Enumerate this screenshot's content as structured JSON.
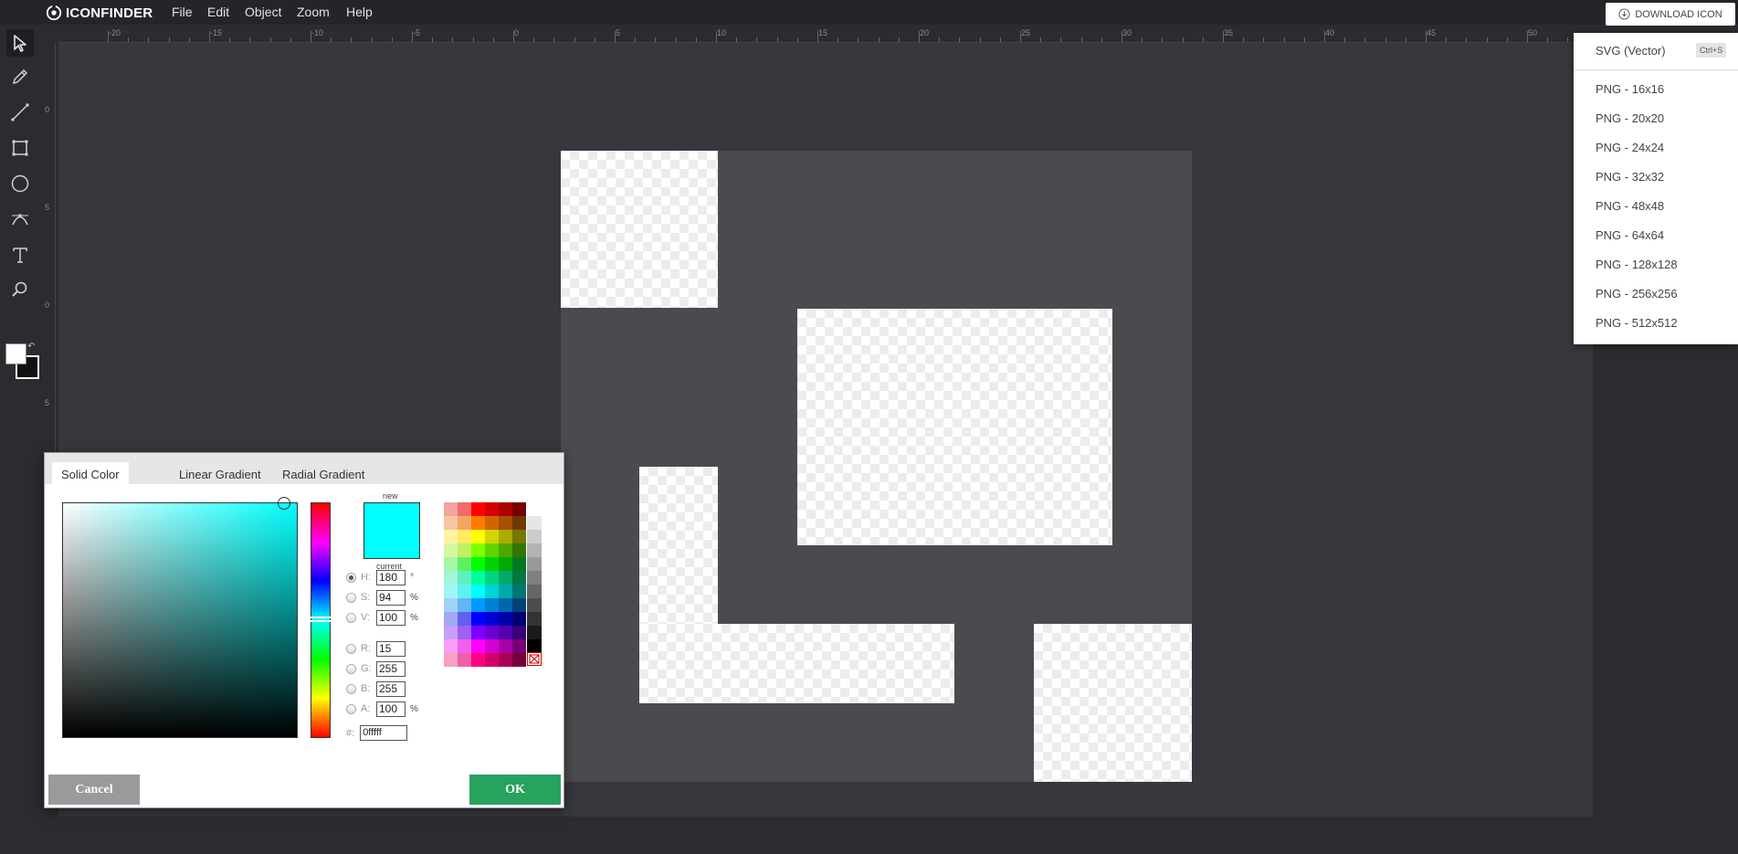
{
  "app": {
    "logo_text": "ICONFINDER"
  },
  "menu": [
    "File",
    "Edit",
    "Object",
    "Zoom",
    "Help"
  ],
  "download": {
    "button_label": "DOWNLOAD ICON",
    "svg_item": "SVG (Vector)",
    "svg_shortcut": "Ctrl+S",
    "png_items": [
      "PNG - 16x16",
      "PNG - 20x20",
      "PNG - 24x24",
      "PNG - 32x32",
      "PNG - 48x48",
      "PNG - 64x64",
      "PNG - 128x128",
      "PNG - 256x256",
      "PNG - 512x512"
    ]
  },
  "tools": [
    "select-tool",
    "pencil-tool",
    "line-tool",
    "rectangle-tool",
    "ellipse-tool",
    "path-tool",
    "text-tool",
    "zoom-tool"
  ],
  "ruler": {
    "top_labels": [
      "-20",
      "-15",
      "-10",
      "-5",
      "0",
      "5",
      "10",
      "15",
      "20",
      "25",
      "30",
      "35",
      "40",
      "45",
      "50"
    ],
    "left_labels": [
      "0",
      "5",
      "0",
      "5"
    ]
  },
  "colors": {
    "fill": "#ffffff",
    "stroke": "#111111",
    "artboard": "#4a4b4f",
    "ok": "#27a35e",
    "cancel": "#9a9a9a"
  },
  "color_picker": {
    "tabs": [
      "Solid Color",
      "Linear Gradient",
      "Radial Gradient"
    ],
    "active_tab": "Solid Color",
    "new_label": "new",
    "current_label": "current",
    "new_color": "#00ffff",
    "fields": [
      {
        "key": "H",
        "label": "H:",
        "value": "180",
        "unit": "°",
        "selected": true
      },
      {
        "key": "S",
        "label": "S:",
        "value": "94",
        "unit": "%",
        "selected": false
      },
      {
        "key": "V",
        "label": "V:",
        "value": "100",
        "unit": "%",
        "selected": false
      },
      {
        "key": "R",
        "label": "R:",
        "value": "15",
        "unit": "",
        "selected": false
      },
      {
        "key": "G",
        "label": "G:",
        "value": "255",
        "unit": "",
        "selected": false
      },
      {
        "key": "B",
        "label": "B:",
        "value": "255",
        "unit": "",
        "selected": false
      },
      {
        "key": "A",
        "label": "A:",
        "value": "100",
        "unit": "%",
        "selected": false
      }
    ],
    "hex_label": "#:",
    "hex_value": "0fffff",
    "cancel_label": "Cancel",
    "ok_label": "OK",
    "palette_rows": [
      [
        "#f4a3a3",
        "#f06b6b",
        "#ff0000",
        "#d40000",
        "#aa0000",
        "#770000"
      ],
      [
        "#f6c6a0",
        "#f4a660",
        "#ff7a00",
        "#d46400",
        "#a55000",
        "#6f3a00"
      ],
      [
        "#fff3a0",
        "#ffec60",
        "#ffff00",
        "#d4d400",
        "#aaaa00",
        "#777700"
      ],
      [
        "#d8f6a0",
        "#bff060",
        "#80ff00",
        "#60d400",
        "#4ca800",
        "#337700"
      ],
      [
        "#a6f6a6",
        "#60f060",
        "#00ff00",
        "#00d400",
        "#00aa00",
        "#007a22"
      ],
      [
        "#a0f6d6",
        "#60f0c0",
        "#00ff99",
        "#00d47f",
        "#00aa66",
        "#007744"
      ],
      [
        "#a0f6f6",
        "#60f0f0",
        "#00ffff",
        "#00d4d4",
        "#00aaaa",
        "#007777"
      ],
      [
        "#a0d2f6",
        "#60b6f0",
        "#0099ff",
        "#0080d4",
        "#0066aa",
        "#004477"
      ],
      [
        "#a6a6f6",
        "#6060f0",
        "#0000ff",
        "#0000d4",
        "#0000aa",
        "#000077"
      ],
      [
        "#c6a0f6",
        "#a060f0",
        "#7f00ff",
        "#6a00d4",
        "#5500aa",
        "#3a0077"
      ],
      [
        "#f6a0f6",
        "#f060f0",
        "#ff00ff",
        "#d400d4",
        "#aa00aa",
        "#770077"
      ],
      [
        "#f6a0c6",
        "#f060a6",
        "#ff0080",
        "#d4006a",
        "#aa0055",
        "#77003a"
      ]
    ],
    "gray_column": [
      "#ffffff",
      "#e6e6e6",
      "#cccccc",
      "#b3b3b3",
      "#999999",
      "#808080",
      "#666666",
      "#4d4d4d",
      "#333333",
      "#1a1a1a",
      "#000000"
    ]
  }
}
